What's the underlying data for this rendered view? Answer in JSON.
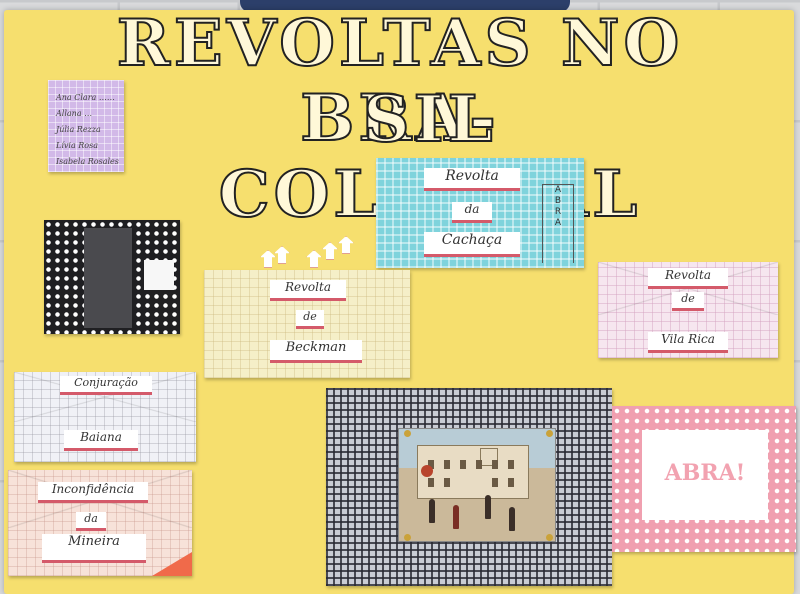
{
  "poster": {
    "title_line1": "REVOLTAS NO BRA-",
    "title_line2": "SIL COLONIAL"
  },
  "names_card": {
    "names": [
      "Ana Clara ……",
      "Allana …",
      "Júlia Rezza",
      "Lívia Rosa",
      "Isabela Rosales"
    ]
  },
  "cards": {
    "cachaca": {
      "line1": "Revolta",
      "line2": "da",
      "line3": "Cachaça",
      "abra": [
        "A",
        "B",
        "R",
        "A"
      ]
    },
    "beckman": {
      "line1": "Revolta",
      "line2": "de",
      "line3": "Beckman"
    },
    "vila_rica": {
      "line1": "Revolta",
      "line2": "de",
      "line3": "Vila Rica"
    },
    "conjuracao": {
      "line1": "Conjuração",
      "line2": "Baiana"
    },
    "inconfidencia": {
      "line1": "Inconfidência",
      "line2": "da",
      "line3": "Mineira"
    },
    "pink_right": {
      "line1": "ABRA!"
    }
  },
  "colors": {
    "board": "#f6df6e",
    "accent_red": "#d45a6a"
  }
}
